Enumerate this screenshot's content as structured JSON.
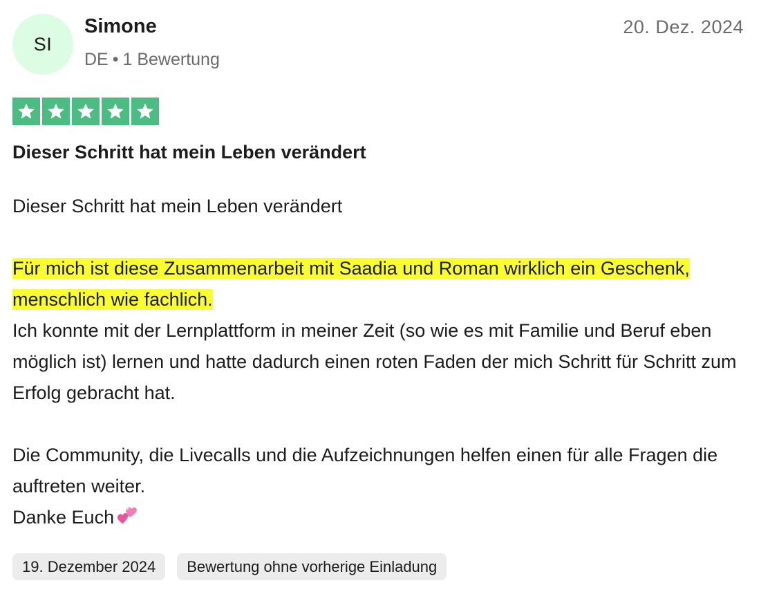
{
  "reviewer": {
    "initials": "SI",
    "name": "Simone",
    "country": "DE",
    "separator": "•",
    "review_count": "1 Bewertung",
    "avatar_color": "#dcfce3"
  },
  "review": {
    "date": "20. Dez. 2024",
    "rating": 5,
    "rating_max": 5,
    "star_color": "#4cbc83",
    "title": "Dieser Schritt hat mein Leben verändert",
    "body": {
      "intro": "Dieser Schritt hat mein Leben verändert",
      "highlighted": "Für mich ist diese Zusammenarbeit mit Saadia und Roman wirklich ein Geschenk, menschlich wie fachlich.",
      "paragraph_1": "Ich konnte mit der Lernplattform in meiner Zeit (so wie es mit Familie und Beruf eben möglich ist) lernen und hatte dadurch einen roten Faden der mich Schritt für Schritt zum Erfolg gebracht hat.",
      "paragraph_2": "Die Community, die Livecalls und die Aufzeichnungen helfen einen für alle Fragen die auftreten weiter.",
      "closing": "Danke Euch",
      "closing_emoji": "two-hearts-icon"
    },
    "highlight_color": "#fbfe2e"
  },
  "tags": {
    "experience_date": "19. Dezember 2024",
    "invitation": "Bewertung ohne vorherige Einladung"
  }
}
